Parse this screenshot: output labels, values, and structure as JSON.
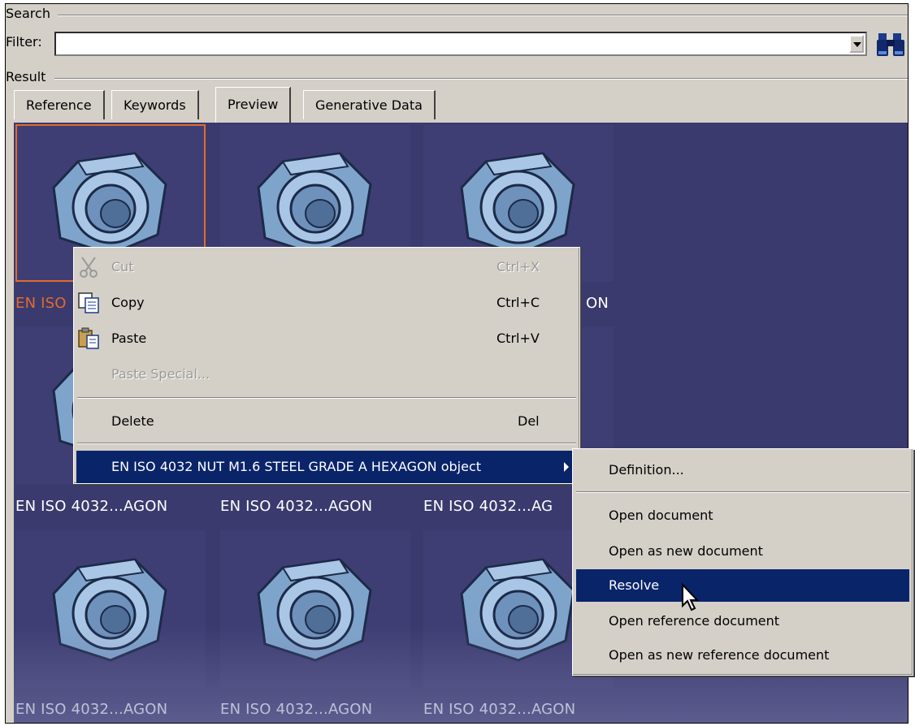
{
  "search": {
    "group_label": "Search",
    "filter_label": "Filter:",
    "filter_value": ""
  },
  "result": {
    "group_label": "Result",
    "tabs": [
      {
        "label": "Reference"
      },
      {
        "label": "Keywords"
      },
      {
        "label": "Preview",
        "active": true
      },
      {
        "label": "Generative Data"
      }
    ]
  },
  "preview": {
    "items": [
      {
        "caption": "EN ISO",
        "selected": true,
        "visible": true
      },
      {
        "caption": "",
        "visible": true
      },
      {
        "caption": "ON",
        "visible": true
      },
      {
        "caption": "EN ISO 4032...AGON"
      },
      {
        "caption": "EN ISO 4032...AGON"
      },
      {
        "caption": "EN ISO 4032...AG"
      },
      {
        "caption": "EN ISO 4032...AGON"
      },
      {
        "caption": "EN ISO 4032...AGON"
      },
      {
        "caption": "EN ISO 4032...AGON"
      }
    ],
    "thumbnail_icon": "hex-nut-icon"
  },
  "context_menu": {
    "items": [
      {
        "label": "Cut",
        "shortcut": "Ctrl+X",
        "disabled": true,
        "icon": "scissors-icon"
      },
      {
        "label": "Copy",
        "shortcut": "Ctrl+C",
        "icon": "copy-icon"
      },
      {
        "label": "Paste",
        "shortcut": "Ctrl+V",
        "icon": "paste-icon"
      },
      {
        "label": "Paste Special...",
        "disabled": true
      },
      {
        "label": "Delete",
        "shortcut": "Del"
      },
      {
        "label": "EN ISO 4032 NUT M1.6 STEEL GRADE A HEXAGON object",
        "highlight": true,
        "submenu": true
      }
    ]
  },
  "submenu": {
    "items": [
      {
        "label": "Definition..."
      },
      {
        "label": "Open document"
      },
      {
        "label": "Open as new document"
      },
      {
        "label": "Resolve",
        "highlight": true
      },
      {
        "label": "Open reference document"
      },
      {
        "label": "Open as new reference document"
      }
    ]
  },
  "colors": {
    "preview_bg": "#3a3a6e",
    "selection": "#e26a2c",
    "menu_highlight": "#0a246a",
    "nut_fill": "#8fb4d8"
  }
}
